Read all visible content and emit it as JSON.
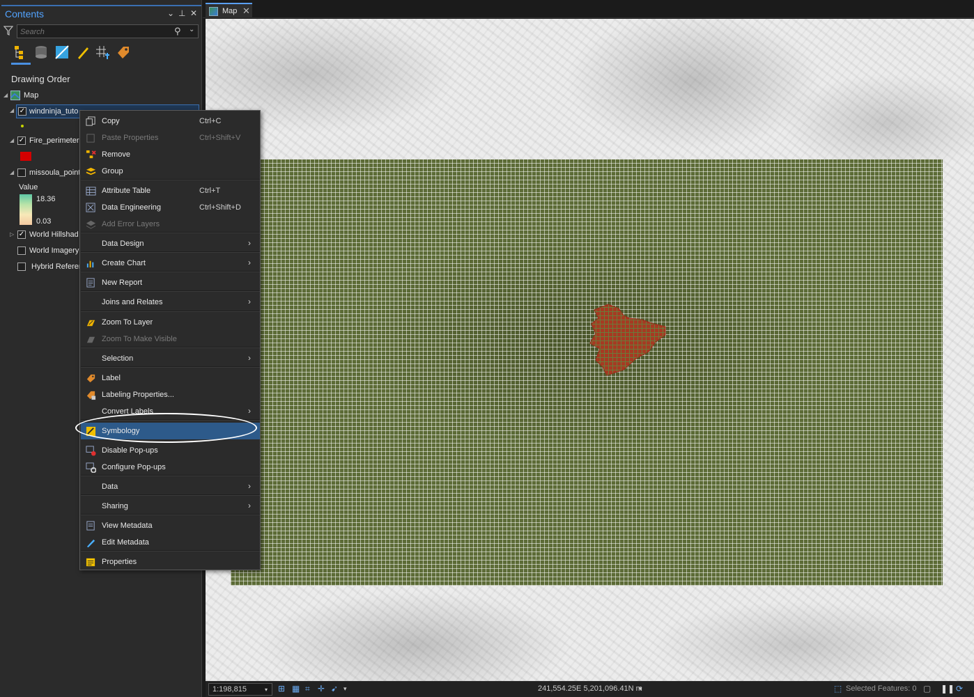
{
  "contents": {
    "title": "Contents",
    "search_placeholder": "Search",
    "heading": "Drawing Order",
    "layers": [
      {
        "label": "Map"
      },
      {
        "label": "windninja_tuto",
        "checked": true
      },
      {
        "label": "Fire_perimeter",
        "checked": true
      },
      {
        "label": "missoula_point",
        "checked": false
      },
      {
        "label": "World Hillshad",
        "checked": true
      },
      {
        "label": "World Imagery",
        "checked": false
      },
      {
        "label": "Hybrid Referer",
        "checked": false
      }
    ],
    "legend": {
      "title": "Value",
      "max": "18.36",
      "min": "0.03"
    }
  },
  "map_tab": {
    "label": "Map"
  },
  "context_menu": {
    "items": [
      {
        "label": "Copy",
        "shortcut": "Ctrl+C",
        "icon": "copy-icon"
      },
      {
        "label": "Paste Properties",
        "shortcut": "Ctrl+Shift+V",
        "icon": "paste-icon",
        "disabled": true
      },
      {
        "label": "Remove",
        "icon": "remove-icon"
      },
      {
        "label": "Group",
        "icon": "group-icon"
      },
      {
        "label": "Attribute Table",
        "shortcut": "Ctrl+T",
        "icon": "table-icon"
      },
      {
        "label": "Data Engineering",
        "shortcut": "Ctrl+Shift+D",
        "icon": "data-engineering-icon"
      },
      {
        "label": "Add Error Layers",
        "icon": "error-layers-icon",
        "disabled": true
      },
      {
        "label": "Data Design",
        "submenu": true
      },
      {
        "label": "Create Chart",
        "submenu": true,
        "icon": "chart-icon"
      },
      {
        "label": "New Report",
        "icon": "report-icon"
      },
      {
        "label": "Joins and Relates",
        "submenu": true
      },
      {
        "label": "Zoom To Layer",
        "icon": "zoom-layer-icon"
      },
      {
        "label": "Zoom To Make Visible",
        "icon": "zoom-visible-icon",
        "disabled": true
      },
      {
        "label": "Selection",
        "submenu": true
      },
      {
        "label": "Label",
        "icon": "label-icon"
      },
      {
        "label": "Labeling Properties...",
        "icon": "labeling-properties-icon"
      },
      {
        "label": "Convert Labels",
        "submenu": true
      },
      {
        "label": "Symbology",
        "icon": "symbology-icon",
        "highlighted": true
      },
      {
        "label": "Disable Pop-ups",
        "icon": "disable-popups-icon"
      },
      {
        "label": "Configure Pop-ups",
        "icon": "configure-popups-icon"
      },
      {
        "label": "Data",
        "submenu": true
      },
      {
        "label": "Sharing",
        "submenu": true
      },
      {
        "label": "View Metadata",
        "icon": "metadata-icon"
      },
      {
        "label": "Edit Metadata",
        "icon": "edit-metadata-icon"
      },
      {
        "label": "Properties",
        "icon": "properties-icon"
      }
    ]
  },
  "statusbar": {
    "scale": "1:198,815",
    "coordinates": "241,554.25E 5,201,096.41N m",
    "selected_features": "Selected Features: 0"
  },
  "colors": {
    "accent": "#4a90e2",
    "fire": "#c0392b",
    "grid": "#5c6b36"
  }
}
